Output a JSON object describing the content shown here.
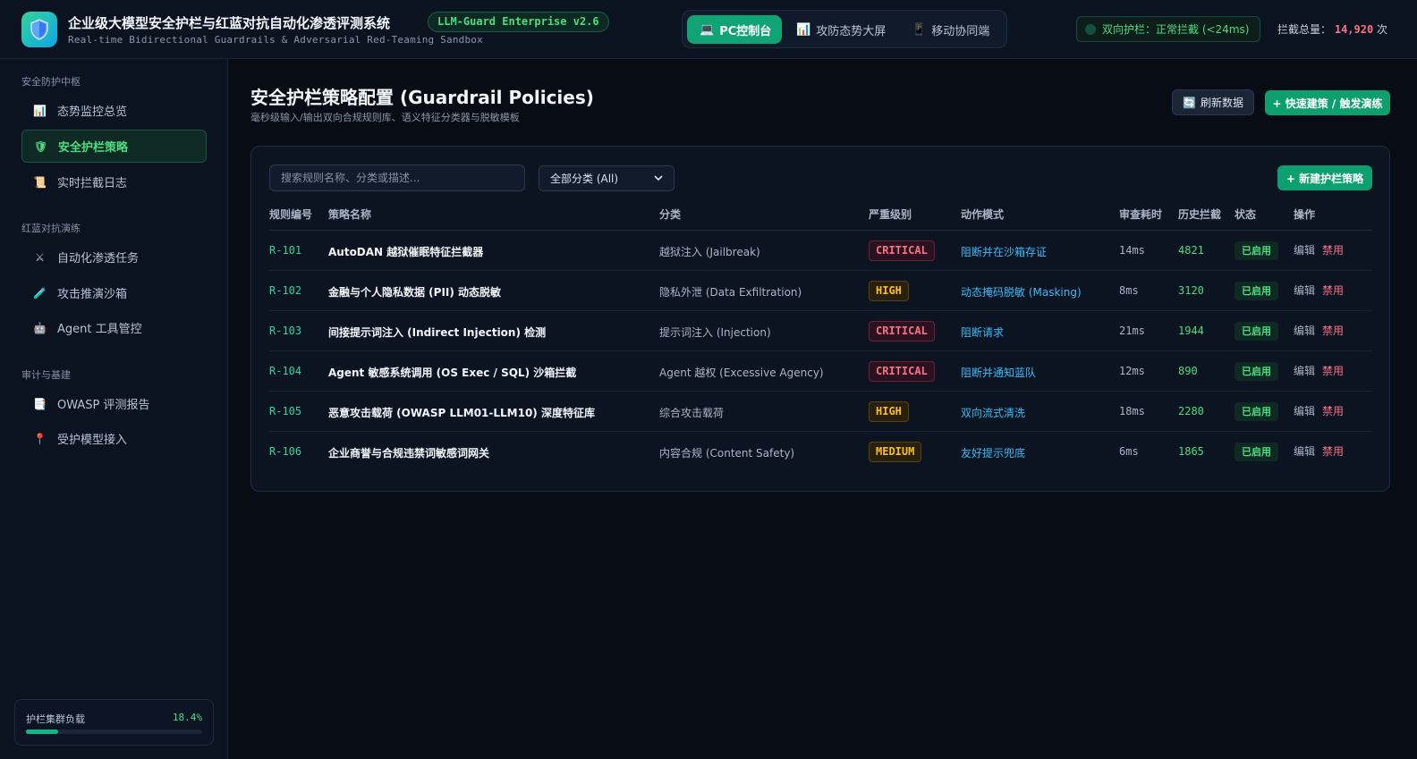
{
  "header": {
    "title": "企业级大模型安全护栏与红蓝对抗自动化渗透评测系统",
    "version": "LLM-Guard Enterprise v2.6",
    "subtitle": "Real-time Bidirectional Guardrails & Adversarial Red-Teaming Sandbox",
    "views": [
      {
        "icon": "💻",
        "label": "PC控制台",
        "active": true
      },
      {
        "icon": "📊",
        "label": "攻防态势大屏",
        "active": false
      },
      {
        "icon": "📱",
        "label": "移动协同端",
        "active": false
      }
    ],
    "guard_status": "双向护栏：正常拦截 (<24ms)",
    "intercept_label": "拦截总量：",
    "intercept_count": "14,920",
    "intercept_unit": "次"
  },
  "sidebar": {
    "sections": [
      {
        "title": "安全防护中枢"
      },
      {
        "title": "红蓝对抗演练"
      },
      {
        "title": "审计与基建"
      }
    ],
    "items": [
      {
        "icon": "📊",
        "label": "态势监控总览"
      },
      {
        "icon": "🛡",
        "label": "安全护栏策略"
      },
      {
        "icon": "📜",
        "label": "实时拦截日志"
      },
      {
        "icon": "⚔",
        "label": "自动化渗透任务"
      },
      {
        "icon": "🧪",
        "label": "攻击推演沙箱"
      },
      {
        "icon": "🤖",
        "label": "Agent 工具管控"
      },
      {
        "icon": "📑",
        "label": "OWASP 评测报告"
      },
      {
        "icon": "📍",
        "label": "受护模型接入"
      }
    ],
    "load": {
      "label": "护栏集群负载",
      "value": "18.4%",
      "fraction": 0.184
    }
  },
  "main": {
    "title": "安全护栏策略配置 (Guardrail Policies)",
    "subtitle": "毫秒级输入/输出双向合规规则库、语义特征分类器与脱敏模板",
    "refresh_icon": "🔄",
    "refresh_label": "刷新数据",
    "quick_label": "+ 快速建策 / 触发演练",
    "search_placeholder": "搜索规则名称、分类或描述...",
    "category_selected": "全部分类 (All)",
    "new_label": "+ 新建护栏策略",
    "columns": [
      "规则编号",
      "策略名称",
      "分类",
      "严重级别",
      "动作模式",
      "审查耗时",
      "历史拦截",
      "状态",
      "操作"
    ],
    "rows": [
      {
        "id": "R-101",
        "name": "AutoDAN 越狱催眠特征拦截器",
        "category": "越狱注入 (Jailbreak)",
        "severity": "CRITICAL",
        "severity_level": "critical",
        "action": "阻断并在沙箱存证",
        "latency": "14ms",
        "hits": "4821",
        "status": "已启用",
        "edit": "编辑",
        "disable": "禁用"
      },
      {
        "id": "R-102",
        "name": "金融与个人隐私数据 (PII) 动态脱敏",
        "category": "隐私外泄 (Data Exfiltration)",
        "severity": "HIGH",
        "severity_level": "high",
        "action": "动态掩码脱敏 (Masking)",
        "latency": "8ms",
        "hits": "3120",
        "status": "已启用",
        "edit": "编辑",
        "disable": "禁用"
      },
      {
        "id": "R-103",
        "name": "间接提示词注入 (Indirect Injection) 检测",
        "category": "提示词注入 (Injection)",
        "severity": "CRITICAL",
        "severity_level": "critical",
        "action": "阻断请求",
        "latency": "21ms",
        "hits": "1944",
        "status": "已启用",
        "edit": "编辑",
        "disable": "禁用"
      },
      {
        "id": "R-104",
        "name": "Agent 敏感系统调用 (OS Exec / SQL) 沙箱拦截",
        "category": "Agent 越权 (Excessive Agency)",
        "severity": "CRITICAL",
        "severity_level": "critical",
        "action": "阻断并通知蓝队",
        "latency": "12ms",
        "hits": "890",
        "status": "已启用",
        "edit": "编辑",
        "disable": "禁用"
      },
      {
        "id": "R-105",
        "name": "恶意攻击载荷 (OWASP LLM01-LLM10) 深度特征库",
        "category": "综合攻击载荷",
        "severity": "HIGH",
        "severity_level": "high",
        "action": "双向流式清洗",
        "latency": "18ms",
        "hits": "2280",
        "status": "已启用",
        "edit": "编辑",
        "disable": "禁用"
      },
      {
        "id": "R-106",
        "name": "企业商誉与合规违禁词敏感词网关",
        "category": "内容合规 (Content Safety)",
        "severity": "MEDIUM",
        "severity_level": "medium",
        "action": "友好提示兜底",
        "latency": "6ms",
        "hits": "1865",
        "status": "已启用",
        "edit": "编辑",
        "disable": "禁用"
      }
    ]
  },
  "colors": {
    "accent": "#10a373",
    "critical": "#fb7185",
    "warning": "#fbbf24",
    "info": "#38bdf8",
    "background": "#080c14"
  }
}
